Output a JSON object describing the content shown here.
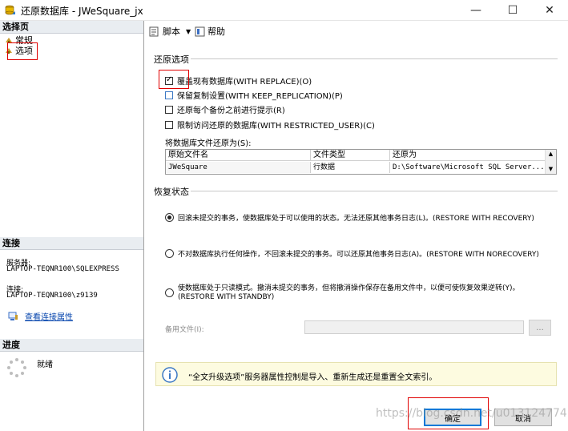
{
  "window": {
    "title": "还原数据库 - JWeSquare_jx",
    "minimize": "—",
    "maximize": "☐",
    "close": "✕"
  },
  "left": {
    "select_page_header": "选择页",
    "pages": [
      {
        "label": "常规"
      },
      {
        "label": "选项"
      }
    ],
    "connection_header": "连接",
    "server_label": "服务器:",
    "server_value": "LAPTOP-TEQNR100\\SQLEXPRESS",
    "connection_label": "连接:",
    "connection_value": "LAPTOP-TEQNR100\\z9139",
    "view_connection_link": "查看连接属性",
    "progress_header": "进度",
    "progress_status": "就绪"
  },
  "toolbar": {
    "script_label": "脚本",
    "help_label": "帮助"
  },
  "restore_options": {
    "title": "还原选项",
    "checkboxes": [
      {
        "label": "覆盖现有数据库(WITH REPLACE)(O)",
        "checked": true
      },
      {
        "label": "保留复制设置(WITH KEEP_REPLICATION)(P)",
        "checked": false
      },
      {
        "label": "还原每个备份之前进行提示(R)",
        "checked": false
      },
      {
        "label": "限制访问还原的数据库(WITH RESTRICTED_USER)(C)",
        "checked": false
      }
    ],
    "files_label": "将数据库文件还原为(S):",
    "grid_headers": [
      "原始文件名",
      "文件类型",
      "还原为"
    ],
    "grid_rows": [
      [
        "JWeSquare",
        "行数据",
        "D:\\Software\\Microsoft SQL Server..."
      ]
    ]
  },
  "recovery": {
    "title": "恢复状态",
    "options": [
      {
        "label": "回滚未提交的事务，使数据库处于可以使用的状态。无法还原其他事务日志(L)。(RESTORE WITH RECOVERY)",
        "checked": true
      },
      {
        "label": "不对数据库执行任何操作，不回滚未提交的事务。可以还原其他事务日志(A)。(RESTORE WITH NORECOVERY)",
        "checked": false
      },
      {
        "label": "使数据库处于只读模式。撤消未提交的事务，但将撤消操作保存在备用文件中，以便可使恢复效果逆转(Y)。",
        "label2": "(RESTORE WITH STANDBY)",
        "checked": false
      }
    ],
    "standby_label": "备用文件(I):",
    "standby_value": "",
    "browse_label": "..."
  },
  "info": {
    "text": "“全文升级选项”服务器属性控制是导入、重新生成还是重置全文索引。"
  },
  "buttons": {
    "ok": "确定",
    "cancel": "取消"
  },
  "watermark": "https://blog.csdn.net/u013124774"
}
